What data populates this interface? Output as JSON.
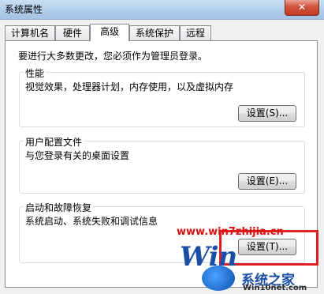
{
  "window": {
    "title": "系统属性",
    "close_label": "✕"
  },
  "tabs": [
    "计算机名",
    "硬件",
    "高级",
    "系统保护",
    "远程"
  ],
  "active_tab": "高级",
  "intro_text": "要进行大多数更改，您必须作为管理员登录。",
  "groups": {
    "performance": {
      "title": "性能",
      "desc": "视觉效果，处理器计划，内存使用，以及虚拟内存",
      "button": "设置(S)..."
    },
    "user_profiles": {
      "title": "用户配置文件",
      "desc": "与您登录有关的桌面设置",
      "button": "设置(E)..."
    },
    "startup_recovery": {
      "title": "启动和故障恢复",
      "desc": "系统启动、系统失败和调试信息",
      "button": "设置(T)..."
    }
  },
  "watermark": {
    "url": "www.win7zhijia.cn",
    "logo_text": "Win",
    "brand": "系统之家",
    "brand_sub": "Win10net.com"
  },
  "colors": {
    "highlight": "#e02020",
    "titlebar": "#aecbe8",
    "brand_blue": "#1b4fa6"
  }
}
